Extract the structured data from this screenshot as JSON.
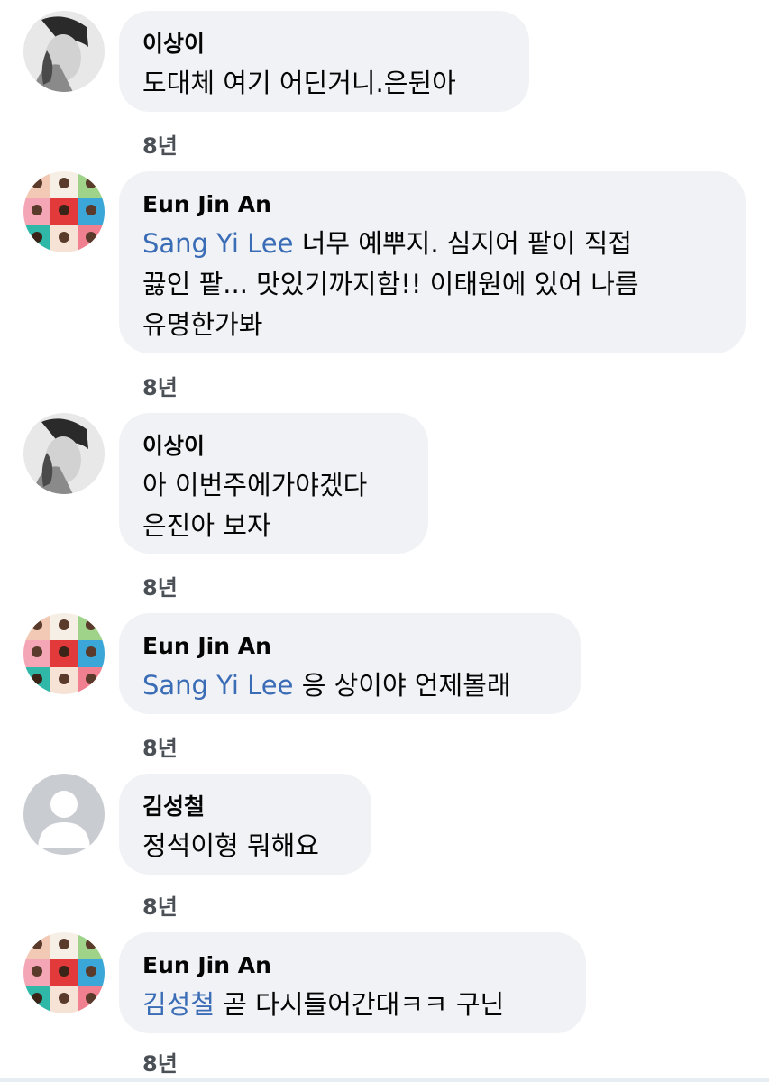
{
  "comments": [
    {
      "author": "이상이",
      "lines": [
        "도대체 여기 어딘거니.은뒨아"
      ],
      "time": "8년"
    },
    {
      "author": "Eun Jin An",
      "mention": "Sang Yi Lee",
      "lines": [
        " 너무 예뿌지. 심지어 팥이 직접",
        "끓인 팥... 맛있기까지함!! 이태원에 있어 나름",
        "유명한가봐"
      ],
      "time": "8년"
    },
    {
      "author": "이상이",
      "lines": [
        "아 이번주에가야겠다",
        "은진아 보자"
      ],
      "time": "8년"
    },
    {
      "author": "Eun Jin An",
      "mention": "Sang Yi Lee",
      "lines": [
        " 응 상이야 언제볼래"
      ],
      "time": "8년"
    },
    {
      "author": "김성철",
      "lines": [
        "정석이형 뭐해요"
      ],
      "time": "8년"
    },
    {
      "author": "Eun Jin An",
      "mention": "김성철",
      "lines": [
        " 곧 다시들어간대ㅋㅋ 구닌"
      ],
      "time": "8년"
    }
  ],
  "colors": {
    "bubble": "#f0f2f5",
    "mention": "#3b6cb6",
    "time": "#4b4f56"
  }
}
